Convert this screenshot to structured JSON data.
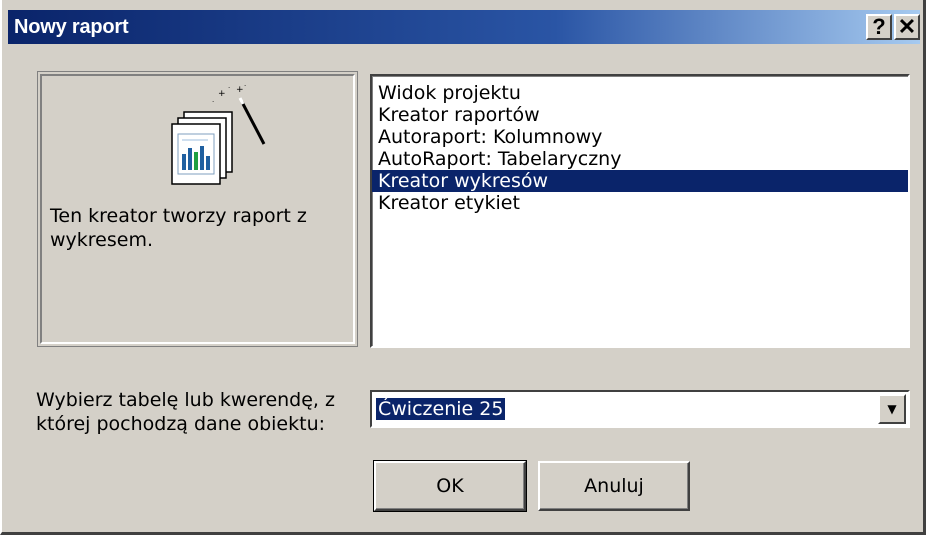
{
  "window": {
    "title": "Nowy raport",
    "help_label": "?",
    "close_label": "✕"
  },
  "preview": {
    "icon": "report-chart-wizard-icon",
    "description": "Ten kreator tworzy raport z wykresem."
  },
  "report_types": {
    "items": [
      {
        "label": "Widok projektu",
        "selected": false
      },
      {
        "label": "Kreator raportów",
        "selected": false
      },
      {
        "label": "Autoraport:  Kolumnowy",
        "selected": false
      },
      {
        "label": "AutoRaport:  Tabelaryczny",
        "selected": false
      },
      {
        "label": "Kreator wykresów",
        "selected": true
      },
      {
        "label": "Kreator etykiet",
        "selected": false
      }
    ]
  },
  "source": {
    "label": "Wybierz tabelę lub kwerendę, z której pochodzą dane obiektu:",
    "value": "Ćwiczenie 25",
    "arrow_icon": "dropdown-arrow-icon"
  },
  "buttons": {
    "ok_label": "OK",
    "cancel_label": "Anuluj"
  },
  "colors": {
    "selection": "#0a246a",
    "dialog_face": "#d4d0c8",
    "titlebar_start": "#0a246a",
    "titlebar_end": "#a6caf0"
  }
}
